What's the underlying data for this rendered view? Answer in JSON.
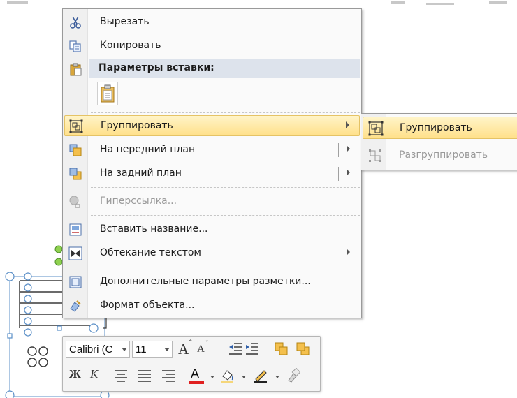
{
  "context_menu": {
    "items": [
      {
        "label": "Вырезать",
        "icon": "scissors-icon",
        "enabled": true
      },
      {
        "label": "Копировать",
        "icon": "copy-icon",
        "enabled": true
      },
      {
        "label": "Группировать",
        "icon": "group-icon",
        "enabled": true,
        "highlighted": true,
        "submenu": true
      },
      {
        "label": "На передний план",
        "icon": "bring-forward-icon",
        "enabled": true,
        "split_submenu": true
      },
      {
        "label": "На задний план",
        "icon": "send-backward-icon",
        "enabled": true,
        "split_submenu": true
      },
      {
        "label": "Гиперссылка...",
        "icon": "hyperlink-icon",
        "enabled": false
      },
      {
        "label": "Вставить название...",
        "icon": "insert-caption-icon",
        "enabled": true
      },
      {
        "label": "Обтекание текстом",
        "icon": "text-wrap-icon",
        "enabled": true,
        "submenu": true
      },
      {
        "label": "Дополнительные параметры разметки...",
        "icon": "layout-options-icon",
        "enabled": true
      },
      {
        "label": "Формат объекта...",
        "icon": "format-object-icon",
        "enabled": true
      }
    ],
    "paste_section": {
      "label": "Параметры вставки:",
      "button_icon": "paste-keep-formatting-icon"
    }
  },
  "group_submenu": {
    "items": [
      {
        "label": "Группировать",
        "icon": "group-icon",
        "enabled": true,
        "highlighted": true
      },
      {
        "label": "Разгруппировать",
        "icon": "ungroup-icon",
        "enabled": false
      }
    ]
  },
  "mini_toolbar": {
    "font_name": "Calibri (C",
    "font_size": "11",
    "bold_glyph": "Ж",
    "italic_glyph": "К",
    "grow_font_glyph": "A",
    "shrink_font_glyph": "A",
    "font_color_glyph": "A",
    "font_color": "#e02020"
  },
  "colors": {
    "highlight_top": "#fff4c8",
    "highlight_bottom": "#ffe08a",
    "highlight_border": "#e5c365",
    "section_bg": "#dde3ec",
    "selection_handle": "#5b8fc7",
    "rotation_handle": "#8fd14f"
  }
}
